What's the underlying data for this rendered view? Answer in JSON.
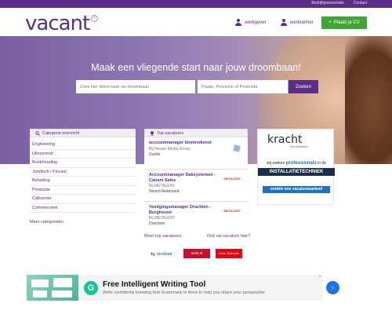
{
  "toplinks": {
    "b2b": "Bedrijfspresentatie",
    "contact": "Contact"
  },
  "logo": {
    "text": "vacant",
    "sup": "V"
  },
  "nav": {
    "employer": "werkgever",
    "employee": "werknemer",
    "cv_button": "Plaats je CV",
    "cv_plus": "+"
  },
  "hero": {
    "title": "Maak een vliegende start naar jouw droombaan!",
    "what_placeholder": "Zoek hier direct naar uw droombaan",
    "where_placeholder": "Plaats, Provincie of Postcode",
    "search_button": "Zoeken"
  },
  "categories": {
    "heading": "Categorie overzicht",
    "items": [
      "Engineering",
      "Uitvoerend",
      "Boekhouding",
      "Juridisch / Fiscaal",
      "Belasting",
      "Productie",
      "Callcenter",
      "Commercieel"
    ],
    "more": "Meer categorieën"
  },
  "vacancies": {
    "heading": "Top vacatures",
    "items": [
      {
        "title": "accountmanager binnendienst",
        "company": "Bij Hessie Media Groep",
        "location": "Zwolle",
        "logo": ""
      },
      {
        "title": "Accountmanager Daksystemen - Canam Sales",
        "company": "Bij METALENT",
        "location": "Noord-Nederland",
        "logo": "METALENT"
      },
      {
        "title": "Vestigingsmanager Drachten - Burghouwt",
        "company": "Bij METALENT",
        "location": "Drachten",
        "logo": "METALENT"
      }
    ],
    "more": "Meer top vacatures",
    "post": "Ook uw vacature hier?"
  },
  "ad": {
    "brand": "kracht",
    "brand_sub": "recruitment",
    "line1_prefix": "wij zoeken",
    "line1_bold": "professionals",
    "line1_suffix": "in de",
    "band": "INSTALLATIETECHNIEK",
    "cta": "ontdek ons vacatureaanbod"
  },
  "partners": {
    "randstad": "randstad",
    "werk": "werk.nl",
    "kruis": "Kruis Techniek"
  },
  "google_ad": {
    "logo": "G",
    "title": "Free Intelligent Writing Tool",
    "text": "Write confidently knowing that Grammarly is there to help you share your perspective",
    "arrow": "›",
    "close": "×"
  },
  "colors": {
    "brand": "#5a2d86",
    "green": "#3fa535"
  }
}
